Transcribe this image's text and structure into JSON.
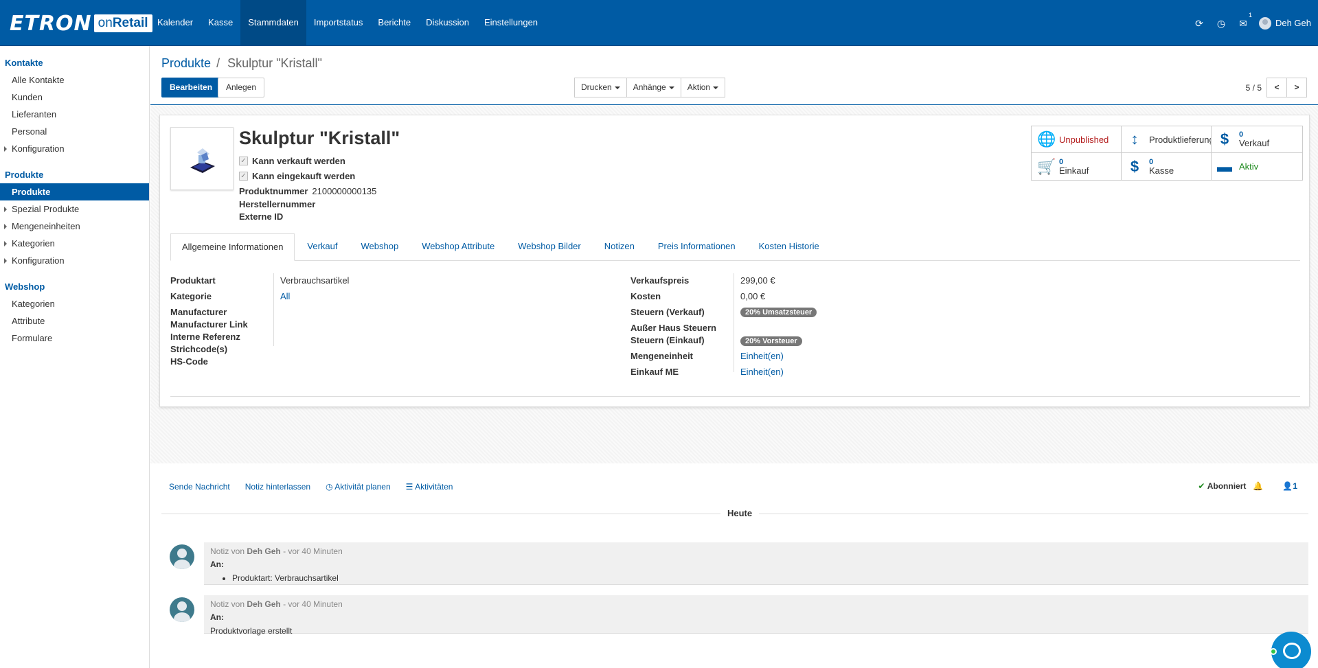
{
  "brand": {
    "name": "ETRON",
    "box_prefix": "on",
    "box_bold": "Retail"
  },
  "topnav": [
    "Kalender",
    "Kasse",
    "Stammdaten",
    "Importstatus",
    "Berichte",
    "Diskussion",
    "Einstellungen"
  ],
  "topright": {
    "messages_badge": "1",
    "user": "Deh Geh"
  },
  "sidebar": {
    "sections": [
      {
        "title": "Kontakte",
        "items": [
          "Alle Kontakte",
          "Kunden",
          "Lieferanten",
          "Personal",
          "Konfiguration"
        ]
      },
      {
        "title": "Produkte",
        "items": [
          "Produkte",
          "Spezial Produkte",
          "Mengeneinheiten",
          "Kategorien",
          "Konfiguration"
        ]
      },
      {
        "title": "Webshop",
        "items": [
          "Kategorien",
          "Attribute",
          "Formulare"
        ]
      }
    ]
  },
  "breadcrumb": {
    "parent": "Produkte",
    "sep": "/",
    "current": "Skulptur \"Kristall\""
  },
  "buttons": {
    "edit": "Bearbeiten",
    "create": "Anlegen",
    "print": "Drucken",
    "attachments": "Anhänge",
    "action": "Aktion"
  },
  "pager": {
    "value": "5 / 5",
    "prev": "<",
    "next": ">"
  },
  "product": {
    "name": "Skulptur \"Kristall\"",
    "can_sell": "Kann verkauft werden",
    "can_purchase": "Kann eingekauft werden",
    "number_label": "Produktnummer",
    "number_value": "2100000000135",
    "manufacturer_no_label": "Herstellernummer",
    "external_id_label": "Externe ID"
  },
  "stats": {
    "unpublished": "Unpublished",
    "delivery": "Produktlieferung",
    "sales_num": "0",
    "sales_label": "Verkauf",
    "purchase_num": "0",
    "purchase_label": "Einkauf",
    "pos_num": "0",
    "pos_label": "Kasse",
    "active": "Aktiv"
  },
  "tabs": [
    "Allgemeine Informationen",
    "Verkauf",
    "Webshop",
    "Webshop Attribute",
    "Webshop Bilder",
    "Notizen",
    "Preis Informationen",
    "Kosten Historie"
  ],
  "left_fields": {
    "produktart_label": "Produktart",
    "produktart_value": "Verbrauchsartikel",
    "kategorie_label": "Kategorie",
    "kategorie_value": "All",
    "manufacturer_label": "Manufacturer",
    "manufacturer_link_label": "Manufacturer Link",
    "interne_ref_label": "Interne Referenz",
    "strichcode_label": "Strichcode(s)",
    "hscode_label": "HS-Code"
  },
  "right_fields": {
    "vk_label": "Verkaufspreis",
    "vk_value": "299,00 €",
    "kosten_label": "Kosten",
    "kosten_value": "0,00 €",
    "steuern_vk_label": "Steuern (Verkauf)",
    "steuern_vk_value": "20% Umsatzsteuer",
    "ausser_haus_label": "Außer Haus Steuern",
    "steuern_ek_label": "Steuern (Einkauf)",
    "steuern_ek_value": "20% Vorsteuer",
    "me_label": "Mengeneinheit",
    "me_value": "Einheit(en)",
    "ek_me_label": "Einkauf ME",
    "ek_me_value": "Einheit(en)"
  },
  "chatter": {
    "send": "Sende Nachricht",
    "note": "Notiz hinterlassen",
    "plan": "Aktivität planen",
    "activities": "Aktivitäten",
    "subscribed": "Abonniert",
    "followers": "1",
    "today": "Heute",
    "messages": [
      {
        "prefix": "Notiz von",
        "author": "Deh Geh",
        "time": "- vor 40 Minuten",
        "to": "An:",
        "bullet": "Produktart: Verbrauchsartikel"
      },
      {
        "prefix": "Notiz von",
        "author": "Deh Geh",
        "time": "- vor 40 Minuten",
        "to": "An:",
        "body": "Produktvorlage erstellt"
      }
    ]
  },
  "colors": {
    "primary": "#005ba4",
    "unpublished": "#b31b1b",
    "active": "#1f8a1f"
  }
}
